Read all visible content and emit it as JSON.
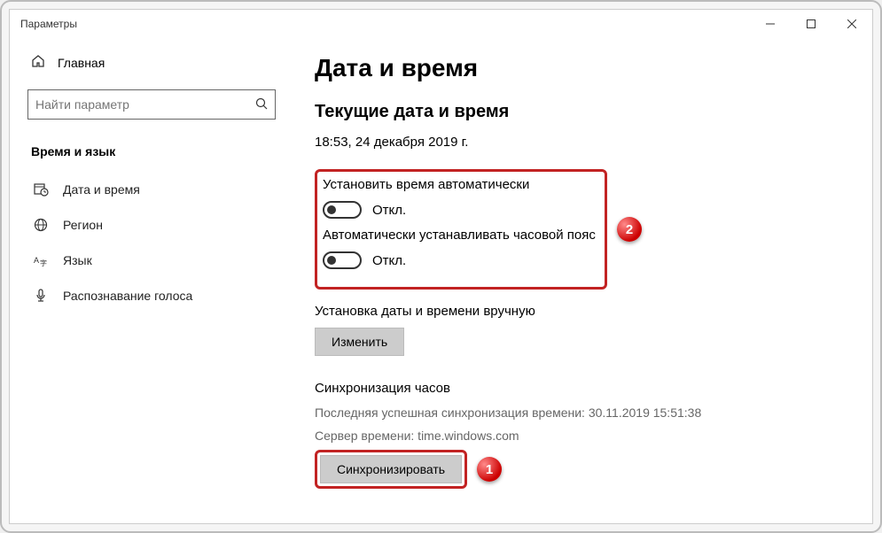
{
  "window": {
    "title": "Параметры"
  },
  "sidebar": {
    "home": "Главная",
    "search_placeholder": "Найти параметр",
    "section_title": "Время и язык",
    "items": [
      {
        "icon": "datetime",
        "label": "Дата и время"
      },
      {
        "icon": "region",
        "label": "Регион"
      },
      {
        "icon": "language",
        "label": "Язык"
      },
      {
        "icon": "speech",
        "label": "Распознавание голоса"
      }
    ]
  },
  "main": {
    "heading": "Дата и время",
    "current_title": "Текущие дата и время",
    "current_value": "18:53, 24 декабря 2019 г.",
    "toggles": {
      "auto_time_label": "Установить время автоматически",
      "auto_time_state": "Откл.",
      "auto_tz_label": "Автоматически устанавливать часовой пояс",
      "auto_tz_state": "Откл."
    },
    "manual": {
      "label": "Установка даты и времени вручную",
      "button": "Изменить"
    },
    "sync": {
      "title": "Синхронизация часов",
      "last_sync": "Последняя успешная синхронизация времени: 30.11.2019 15:51:38",
      "server": "Сервер времени: time.windows.com",
      "button": "Синхронизировать"
    }
  },
  "callouts": {
    "one": "1",
    "two": "2"
  }
}
